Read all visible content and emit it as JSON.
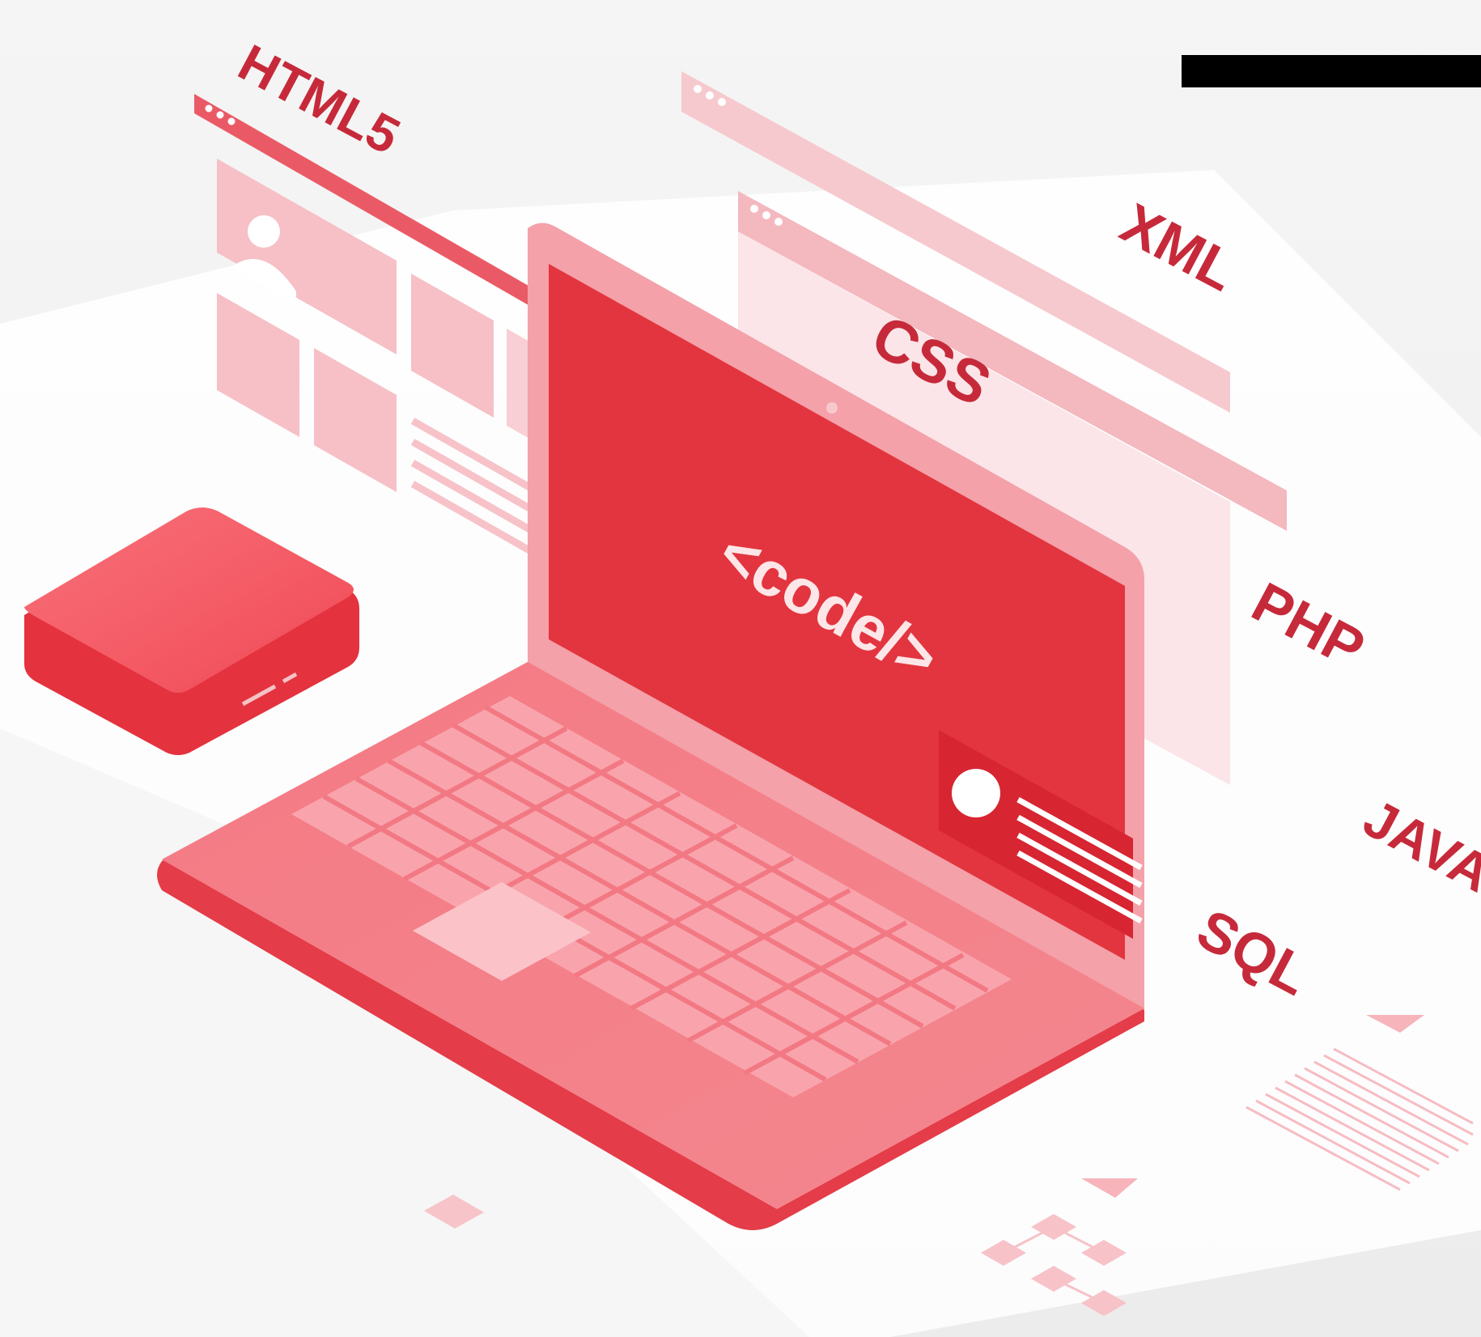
{
  "labels": {
    "html5": "HTML5",
    "xml": "XML",
    "css": "CSS",
    "php": "PHP",
    "java": "JAVA",
    "sql": "SQL"
  },
  "screen_text": "<code/>",
  "colors": {
    "background": "#f1f1f1",
    "accent": "#e53e46",
    "accent_dark": "#c62a3a",
    "accent_light": "#f7b9bf",
    "pale": "#fbdde1"
  },
  "objects": [
    "laptop",
    "keyboard",
    "touchpad",
    "server-box",
    "webpage-window",
    "code-window",
    "black-bar",
    "flowchart-icon",
    "document-icon"
  ]
}
